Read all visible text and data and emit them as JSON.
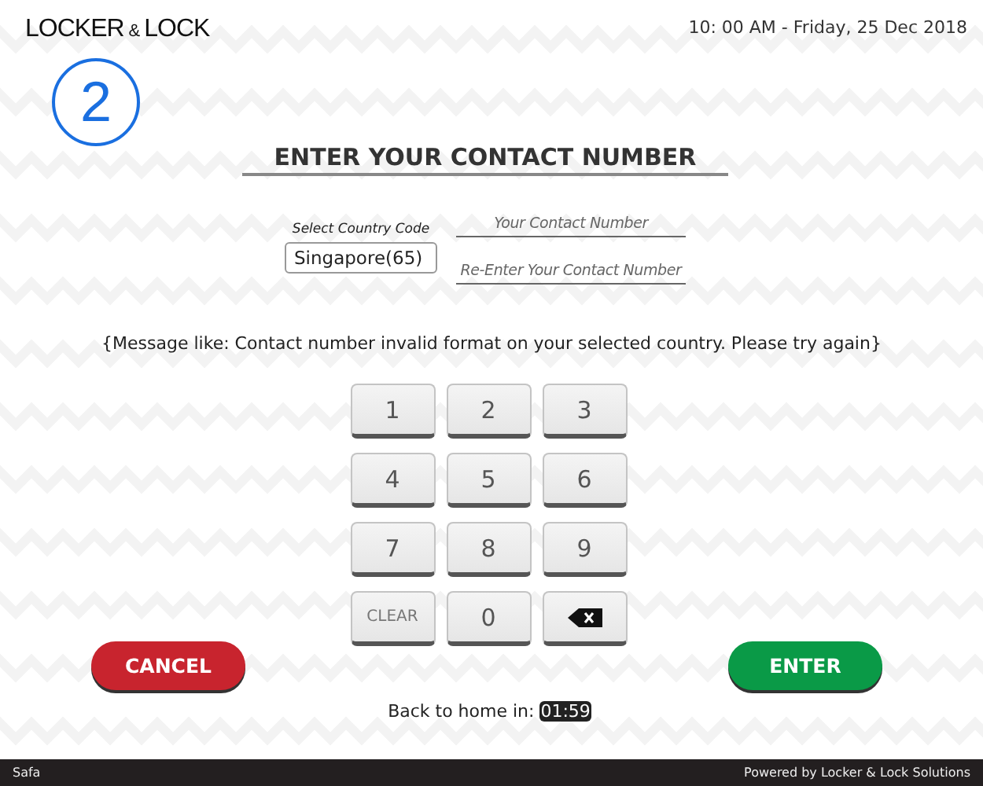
{
  "logo": [
    "LOCKER",
    "&",
    "LOCK"
  ],
  "datetime": "10: 00 AM - Friday, 25 Dec 2018",
  "step": "2",
  "title": "ENTER YOUR CONTACT NUMBER",
  "country": {
    "label": "Select Country Code",
    "value": "Singapore(65)"
  },
  "contact_fields": [
    {
      "placeholder": "Your Contact Number"
    },
    {
      "placeholder": "Re-Enter Your Contact Number"
    }
  ],
  "message": "{Message like: Contact number invalid format on your selected country. Please try again}",
  "keypad": [
    {
      "kind": "digit",
      "label": "1"
    },
    {
      "kind": "digit",
      "label": "2"
    },
    {
      "kind": "digit",
      "label": "3"
    },
    {
      "kind": "digit",
      "label": "4"
    },
    {
      "kind": "digit",
      "label": "5"
    },
    {
      "kind": "digit",
      "label": "6"
    },
    {
      "kind": "digit",
      "label": "7"
    },
    {
      "kind": "digit",
      "label": "8"
    },
    {
      "kind": "digit",
      "label": "9"
    },
    {
      "kind": "clear",
      "label": "CLEAR"
    },
    {
      "kind": "digit",
      "label": "0"
    },
    {
      "kind": "backspace"
    }
  ],
  "buttons": [
    {
      "kind": "cancel",
      "label": "CANCEL"
    },
    {
      "kind": "enter",
      "label": "ENTER"
    }
  ],
  "countdown": {
    "label": "Back to home in:",
    "time": "01:59"
  },
  "footer": {
    "left": "Safa",
    "right": "Powered by Locker & Lock Solutions"
  }
}
